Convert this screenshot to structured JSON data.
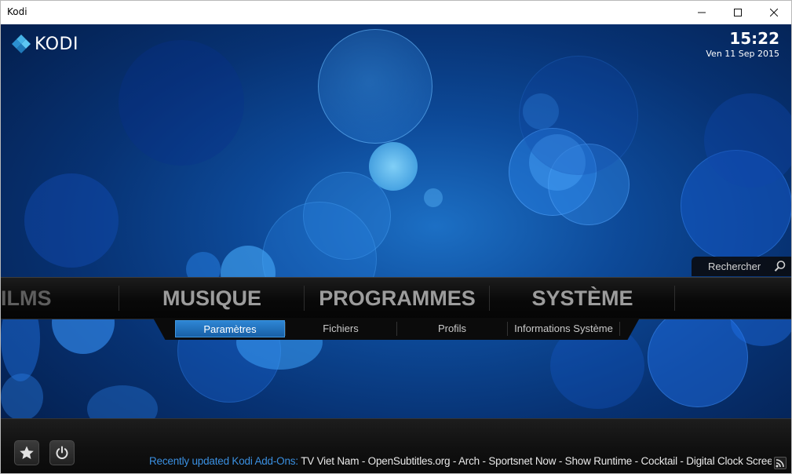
{
  "window": {
    "title": "Kodi"
  },
  "header": {
    "logo_text": "KODI",
    "time": "15:22",
    "date": "Ven 11 Sep 2015"
  },
  "search": {
    "label": "Rechercher"
  },
  "main_menu": {
    "items": [
      {
        "label": "ILMS"
      },
      {
        "label": "MUSIQUE"
      },
      {
        "label": "PROGRAMMES"
      },
      {
        "label": "SYSTÈME"
      }
    ]
  },
  "sub_menu": {
    "items": [
      {
        "label": "Paramètres"
      },
      {
        "label": "Fichiers"
      },
      {
        "label": "Profils"
      },
      {
        "label": "Informations Système"
      }
    ],
    "selected": "Paramètres"
  },
  "footer": {
    "ticker_heading": "Recently updated Kodi Add-Ons:",
    "ticker_text": " TV Viet Nam - OpenSubtitles.org - Arch - Sportsnet Now - Show Runtime - Cocktail - Digital Clock Screensaver"
  },
  "colors": {
    "accent": "#2e86d4",
    "ticker_heading": "#3a8fe0",
    "background": "#0d4a99"
  },
  "icons": [
    "kodi-logo-icon",
    "search-icon",
    "favourites-star-icon",
    "power-icon",
    "rss-icon",
    "minimize-icon",
    "maximize-icon",
    "close-icon"
  ]
}
